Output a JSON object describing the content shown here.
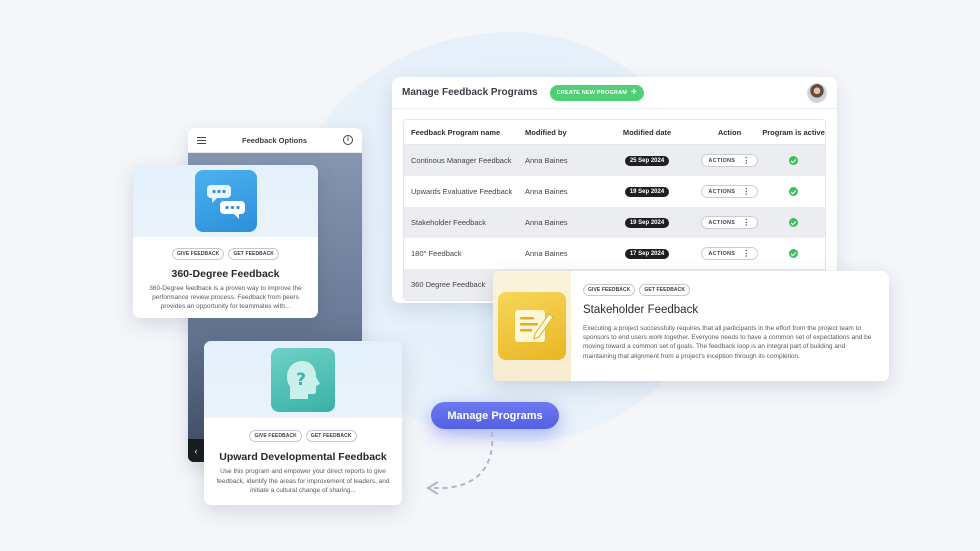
{
  "manage": {
    "title": "Manage Feedback Programs",
    "create_label": "CREATE NEW PROGRAM",
    "columns": [
      "Feedback Program name",
      "Modified by",
      "Modified date",
      "Action",
      "Program is active"
    ],
    "rows": [
      {
        "name": "Continous Manager Feedback",
        "by": "Anna Baines",
        "date": "25 Sep 2024",
        "action": "ACTIONS"
      },
      {
        "name": "Upwards Evaluative Feedback",
        "by": "Anna Baines",
        "date": "19 Sep 2024",
        "action": "ACTIONS"
      },
      {
        "name": "Stakeholder Feedback",
        "by": "Anna Baines",
        "date": "19 Sep 2024",
        "action": "ACTIONS"
      },
      {
        "name": "180° Feedback",
        "by": "Anna Baines",
        "date": "17 Sep 2024",
        "action": "ACTIONS"
      },
      {
        "name": "360 Degree Feedback",
        "by": "",
        "date": "",
        "action": ""
      }
    ]
  },
  "phone": {
    "title": "Feedback Options",
    "back": "‹"
  },
  "tags": {
    "give": "GIVE FEEDBACK",
    "get": "GET FEEDBACK"
  },
  "card1": {
    "title": "360-Degree Feedback",
    "desc": "360-Degree feedback is a proven way to improve the performance review process. Feedback from peers provides an opportunity for teammates with..."
  },
  "card2": {
    "title": "Upward Developmental Feedback",
    "desc": "Use this program and empower your direct reports to give feedback, identify the areas for improvement of leaders, and initiate a cultural change of sharing..."
  },
  "card3": {
    "title": "Stakeholder Feedback",
    "desc": "Executing a project successfully requires that all participants in the effort from the project team to sponsors to end users work together. Everyone needs to have a common set of expectations and be moving toward a common set of goals. The feedback loop is an integral part of building and maintaining that alignment from a project's inception through its completion."
  },
  "pill_label": "Manage Programs",
  "colors": {
    "accent": "#5360e2",
    "create_green": "#4fcf76",
    "active_green": "#3fbf62",
    "date_pill": "#1e1f22"
  },
  "icons": [
    "menu-icon",
    "info-icon",
    "plus-icon",
    "kebab-icon",
    "check-icon",
    "chat-bubbles-icon",
    "head-question-icon",
    "note-pen-icon",
    "dashed-arrow-icon"
  ]
}
